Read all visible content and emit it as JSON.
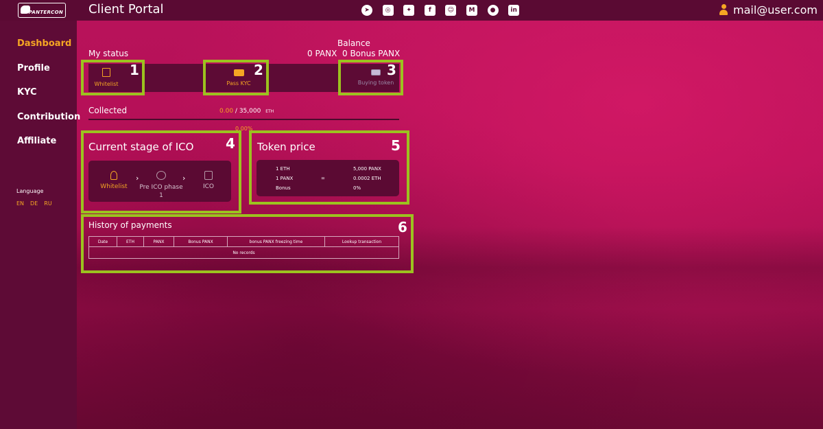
{
  "header": {
    "logo_text": "PANTERCON",
    "title": "Client Portal",
    "socials": [
      {
        "icon": "telegram-icon",
        "glyph": "➤"
      },
      {
        "icon": "instagram-icon",
        "glyph": "◎"
      },
      {
        "icon": "twitter-icon",
        "glyph": "✦"
      },
      {
        "icon": "facebook-icon",
        "glyph": "f"
      },
      {
        "icon": "discord-icon",
        "glyph": "☺"
      },
      {
        "icon": "medium-icon",
        "glyph": "M"
      },
      {
        "icon": "reddit-icon",
        "glyph": "●"
      },
      {
        "icon": "linkedin-icon",
        "glyph": "in"
      }
    ],
    "user_email": "mail@user.com"
  },
  "sidebar": {
    "items": [
      {
        "label": "Dashboard",
        "active": true
      },
      {
        "label": "Profile",
        "active": false
      },
      {
        "label": "KYC",
        "active": false
      },
      {
        "label": "Contribution",
        "active": false
      },
      {
        "label": "Affiliate",
        "active": false
      }
    ],
    "language_label": "Language",
    "languages": [
      "EN",
      "DE",
      "RU"
    ]
  },
  "balance": {
    "label": "Balance",
    "panx": "0 PANX",
    "bonus": "0 Bonus PANX"
  },
  "status": {
    "label": "My status",
    "steps": [
      {
        "label": "Whitelist",
        "icon": "document-icon",
        "color": "#f5a623"
      },
      {
        "label": "Pass KYC",
        "icon": "id-card-icon",
        "color": "#f5a623"
      },
      {
        "label": "Buying token",
        "icon": "buy-icon",
        "color": "#9a8aa8"
      }
    ]
  },
  "collected": {
    "label": "Collected",
    "current": "0.00",
    "separator": " / ",
    "total": "35,000",
    "unit": "ETH",
    "percent": "0.00%"
  },
  "ico_stage": {
    "title": "Current stage of ICO",
    "stages": [
      {
        "label": "Whitelist",
        "icon": "person-icon",
        "active": true
      },
      {
        "label": "Pre ICO phase 1",
        "icon": "group-icon",
        "active": false
      },
      {
        "label": "ICO",
        "icon": "crowd-icon",
        "active": false
      }
    ],
    "chevron": "›"
  },
  "token_price": {
    "title": "Token price",
    "rows": [
      {
        "left": "1 ETH",
        "mid": "",
        "right": "5,000 PANX"
      },
      {
        "left": "1 PANX",
        "mid": "=",
        "right": "0.0002 ETH"
      },
      {
        "left": "Bonus",
        "mid": "",
        "right": "0%"
      }
    ]
  },
  "history": {
    "title": "History of payments",
    "columns": [
      "Date",
      "ETH",
      "PANX",
      "Bonus PANX",
      "bonus PANX freezing time",
      "Lookup transaction"
    ],
    "empty_text": "No records"
  },
  "annotations": [
    "1",
    "2",
    "3",
    "4",
    "5",
    "6"
  ],
  "colors": {
    "accent": "#f5a623",
    "highlight": "#9cc21f",
    "panel": "#5d0b35"
  }
}
